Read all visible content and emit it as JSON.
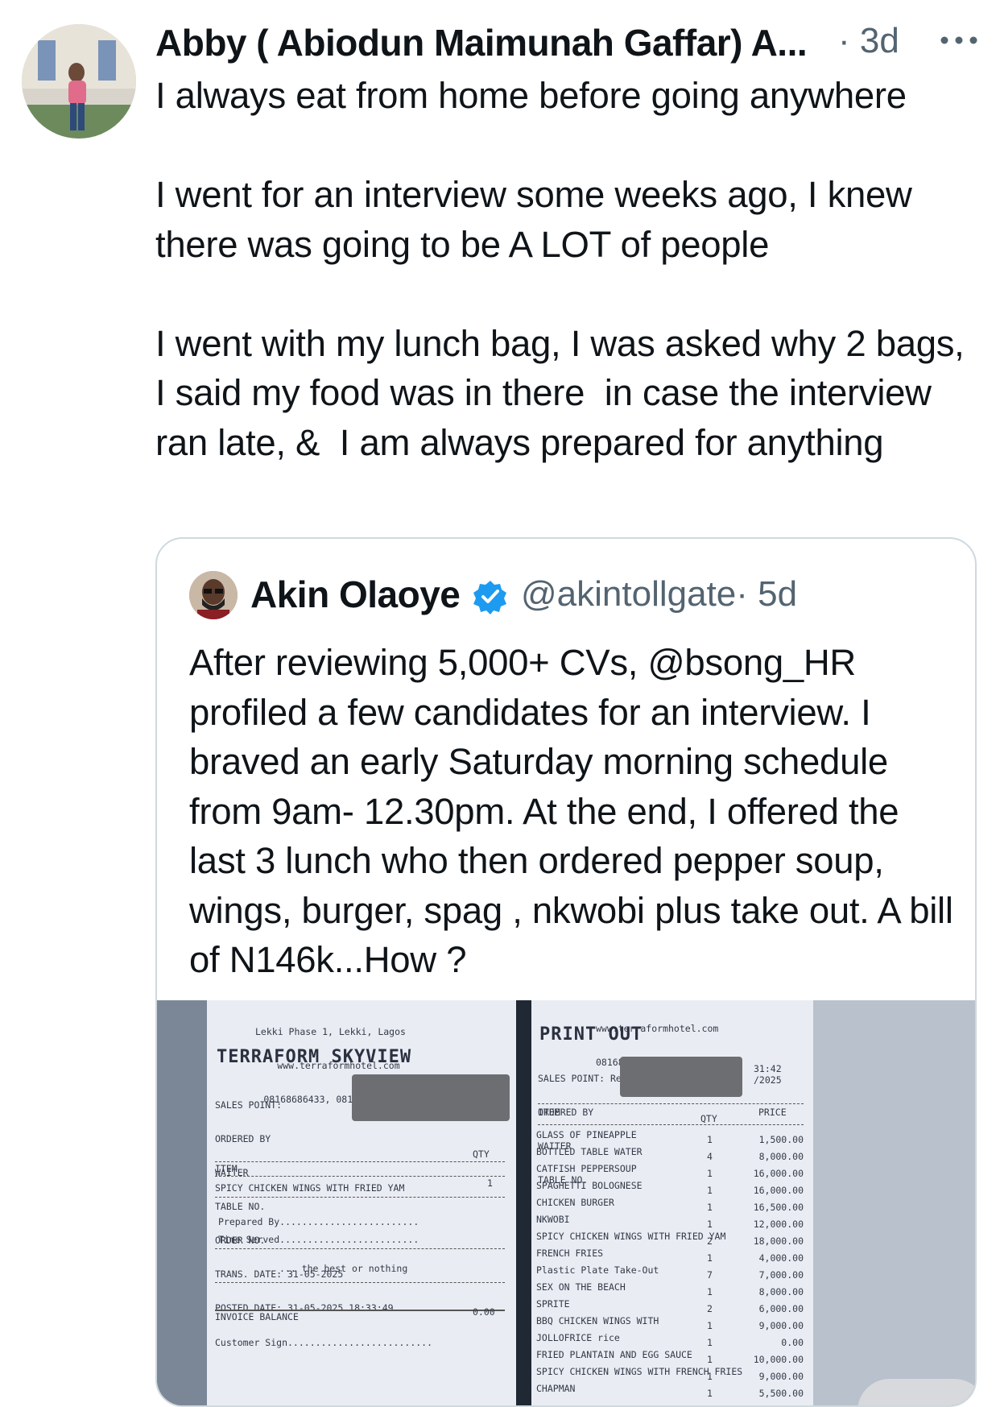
{
  "tweet": {
    "author": "Abby ( Abiodun Maimunah Gaffar) A...",
    "time": "· 3d",
    "text": "I always eat from home before going anywhere\n\nI went for an interview some weeks ago, I knew there was going to be A LOT of people\n\nI went with my lunch bag, I was asked why 2 bags, I said my food was in there  in case the interview ran late, &  I am always prepared for anything"
  },
  "quote": {
    "name": "Akin Olaoye",
    "handle": "@akintollgate",
    "time": "· 5d",
    "text": "After reviewing 5,000+ CVs, @bsong_HR profiled a few candidates for an interview. I braved an early Saturday morning schedule from 9am- 12.30pm. At the end, I offered the last 3 lunch who then ordered pepper soup, wings, burger, spag , nkwobi plus take out. A bill of N146k...How ?"
  },
  "receipt_left": {
    "addr1": "Lekki Phase 1, Lekki, Lagos",
    "web": "www.terraformhotel.com",
    "phones": "08168686433, 08170000037",
    "title": "TERRAFORM SKYVIEW",
    "sales_point": "SALES POINT:",
    "ordered_by": "ORDERED BY",
    "waiter": "WAITER",
    "table_no": "TABLE NO.",
    "order_no": "ORDER NO.",
    "trans_date": "TRANS. DATE: 31-05-2025",
    "posted_date": "POSTED DATE: 31-05-2025 18:33:49",
    "qty_header": "QTY",
    "item_header": "ITEM",
    "item1": "SPICY CHICKEN WINGS WITH FRIED YAM",
    "item1_qty": "1",
    "prepared_by": "Prepared By.........................",
    "time_served": "Time Served.........................",
    "tagline": "... the best or nothing",
    "invoice_balance": "INVOICE BALANCE",
    "invoice_amount": "0.00",
    "customer_sign": "Customer Sign.........................."
  },
  "receipt_right": {
    "web": "www.terraformhotel.com",
    "phones": "08168686433, 08170000037",
    "title": "PRINT OUT",
    "sales_point": "SALES POINT: Restaurant n Bar",
    "ordered_by": "ORDERED BY",
    "waiter": "WAITER",
    "table_no": "TABLE NO.",
    "time_frag": "31:42",
    "date_frag": "/2025",
    "item_header": "ITEM",
    "qty_header": "QTY",
    "price_header": "PRICE",
    "items": [
      {
        "name": "GLASS OF PINEAPPLE",
        "qty": "1",
        "price": "1,500.00"
      },
      {
        "name": "BOTTLED TABLE WATER",
        "qty": "4",
        "price": "8,000.00"
      },
      {
        "name": "CATFISH PEPPERSOUP",
        "qty": "1",
        "price": "16,000.00"
      },
      {
        "name": "SPAGHETTI BOLOGNESE",
        "qty": "1",
        "price": "16,000.00"
      },
      {
        "name": "CHICKEN BURGER",
        "qty": "1",
        "price": "16,500.00"
      },
      {
        "name": "NKWOBI",
        "qty": "1",
        "price": "12,000.00"
      },
      {
        "name": "SPICY CHICKEN WINGS WITH FRIED YAM",
        "qty": "2",
        "price": "18,000.00"
      },
      {
        "name": "FRENCH FRIES",
        "qty": "1",
        "price": "4,000.00"
      },
      {
        "name": "Plastic Plate Take-Out",
        "qty": "7",
        "price": "7,000.00"
      },
      {
        "name": "SEX ON THE BEACH",
        "qty": "1",
        "price": "8,000.00"
      },
      {
        "name": "SPRITE",
        "qty": "2",
        "price": "6,000.00"
      },
      {
        "name": "BBQ CHICKEN WINGS WITH",
        "qty": "1",
        "price": "9,000.00"
      },
      {
        "name": "JOLLOFRICE rice",
        "qty": "1",
        "price": "0.00"
      },
      {
        "name": "FRIED PLANTAIN AND EGG SAUCE",
        "qty": "1",
        "price": "10,000.00"
      },
      {
        "name": "SPICY CHICKEN WINGS WITH FRENCH FRIES",
        "qty": "1",
        "price": "9,000.00"
      },
      {
        "name": "CHAPMAN",
        "qty": "1",
        "price": "5,500.00"
      }
    ]
  }
}
